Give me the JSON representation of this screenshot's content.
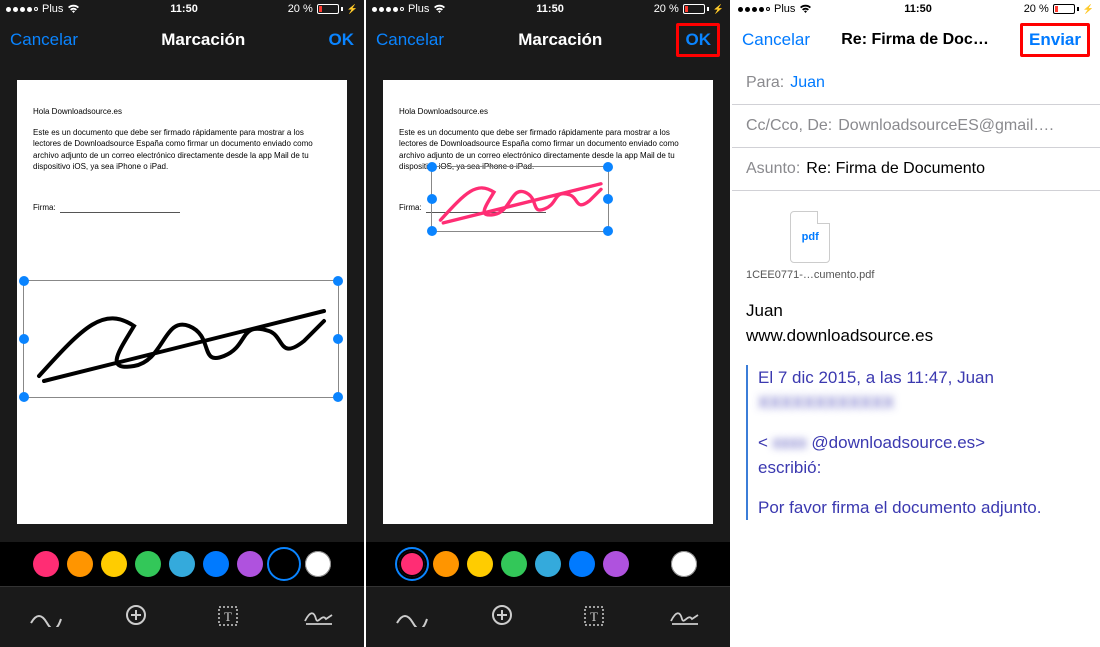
{
  "status": {
    "carrier": "Plus",
    "time": "11:50",
    "battery_text": "20 %"
  },
  "markup": {
    "cancel": "Cancelar",
    "title": "Marcación",
    "ok": "OK"
  },
  "doc": {
    "greeting": "Hola Downloadsource.es",
    "body": "Este es un documento que debe ser firmado rápidamente para mostrar a los lectores de Downloadsource España como firmar un documento enviado como archivo adjunto de un correo electrónico directamente desde la app Mail de tu dispositivo iOS, ya sea iPhone o iPad.",
    "sig_label": "Firma:"
  },
  "colors": {
    "palette": [
      "#ff2d74",
      "#ff9500",
      "#ffcc00",
      "#33c759",
      "#34aadc",
      "#007aff",
      "#af52de",
      "#000000",
      "#ffffff"
    ],
    "selected_p1": 7,
    "selected_p2": 0
  },
  "tools": {
    "icons": [
      "pen-icon",
      "magnify-icon",
      "text-icon",
      "signature-icon"
    ]
  },
  "mail": {
    "cancel": "Cancelar",
    "title": "Re: Firma de Doc…",
    "send": "Enviar",
    "to_label": "Para:",
    "to_value": "Juan",
    "cc_label": "Cc/Cco, De:",
    "cc_value": "DownloadsourceES@gmail….",
    "subject_label": "Asunto:",
    "subject_value": "Re: Firma de Documento",
    "attachment_badge": "pdf",
    "attachment_name": "1CEE0771-…cumento.pdf",
    "line1": "Juan",
    "line2": "www.downloadsource.es",
    "quote_header": "El 7 dic 2015, a las 11:47, Juan",
    "quote_addr_open": "<",
    "quote_addr_domain": "@downloadsource.es>",
    "quote_wrote": "escribió:",
    "quote_body": "Por favor firma el documento adjunto."
  }
}
